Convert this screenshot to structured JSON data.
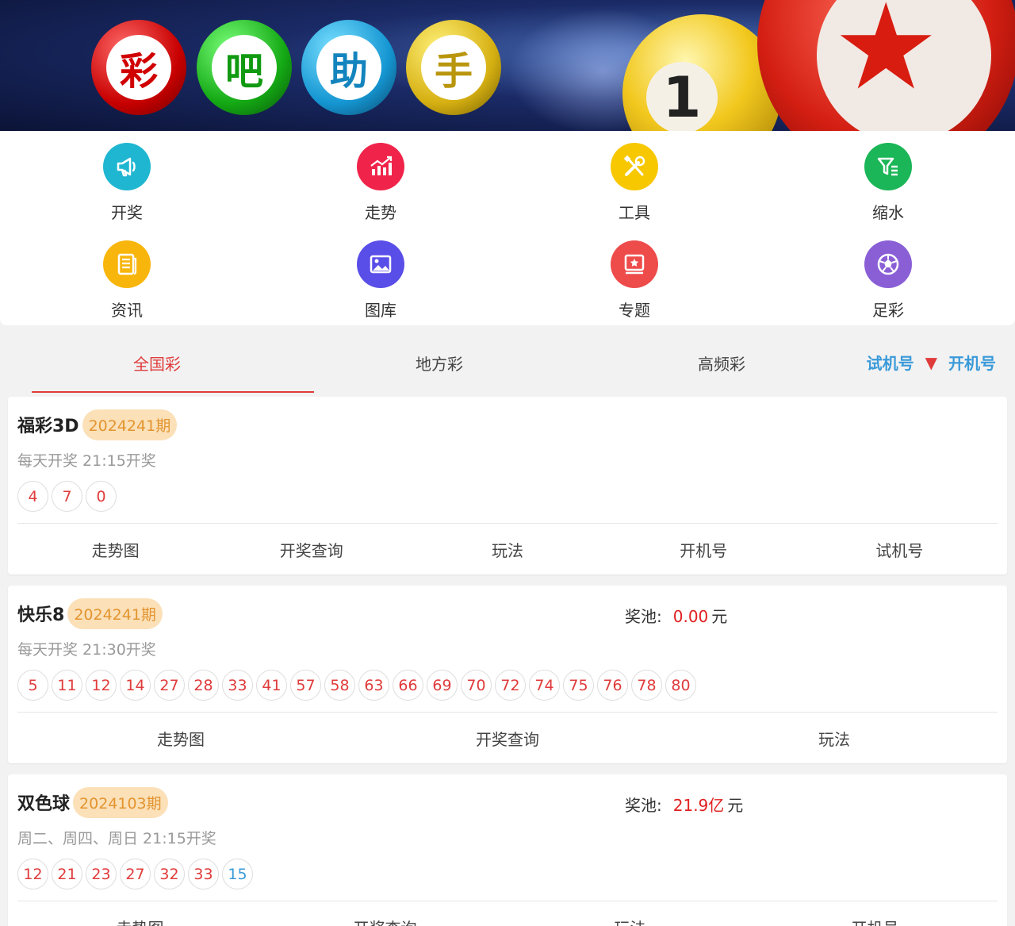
{
  "banner": {
    "balls": [
      "彩",
      "吧",
      "助",
      "手"
    ],
    "yellow_ball_number": "1",
    "star_icon": "star-icon"
  },
  "menu": [
    {
      "label": "开奖",
      "icon": "megaphone-icon",
      "color": "#1fb6d1"
    },
    {
      "label": "走势",
      "icon": "trend-chart-icon",
      "color": "#f0244a"
    },
    {
      "label": "工具",
      "icon": "tools-icon",
      "color": "#f7c800"
    },
    {
      "label": "缩水",
      "icon": "filter-icon",
      "color": "#1bb657"
    },
    {
      "label": "资讯",
      "icon": "news-icon",
      "color": "#f8b50c"
    },
    {
      "label": "图库",
      "icon": "gallery-icon",
      "color": "#5a4ee8"
    },
    {
      "label": "专题",
      "icon": "topic-icon",
      "color": "#ee4b4b"
    },
    {
      "label": "足彩",
      "icon": "football-icon",
      "color": "#8a5fd6"
    }
  ],
  "tabs": {
    "items": [
      "全国彩",
      "地方彩",
      "高频彩"
    ],
    "active_index": 0,
    "link_trial": "试机号",
    "link_open": "开机号"
  },
  "lotteries": [
    {
      "name": "福彩3D",
      "issue": "2024241期",
      "time": "每天开奖 21:15开奖",
      "numbers": [
        "4",
        "7",
        "0"
      ],
      "blue_numbers": [],
      "actions": [
        "走势图",
        "开奖查询",
        "玩法",
        "开机号",
        "试机号"
      ]
    },
    {
      "name": "快乐8",
      "issue": "2024241期",
      "time": "每天开奖 21:30开奖",
      "pool_label": "奖池:",
      "pool_amount": "0.00",
      "pool_unit": "元",
      "numbers": [
        "5",
        "11",
        "12",
        "14",
        "27",
        "28",
        "33",
        "41",
        "57",
        "58",
        "63",
        "66",
        "69",
        "70",
        "72",
        "74",
        "75",
        "76",
        "78",
        "80"
      ],
      "blue_numbers": [],
      "actions": [
        "走势图",
        "开奖查询",
        "玩法"
      ]
    },
    {
      "name": "双色球",
      "issue": "2024103期",
      "time": "周二、周四、周日 21:15开奖",
      "pool_label": "奖池:",
      "pool_amount": "21.9亿",
      "pool_unit": "元",
      "numbers": [
        "12",
        "21",
        "23",
        "27",
        "32",
        "33"
      ],
      "blue_numbers": [
        "15"
      ],
      "actions": [
        "走势图",
        "开奖查询",
        "玩法",
        "开机号"
      ]
    }
  ]
}
